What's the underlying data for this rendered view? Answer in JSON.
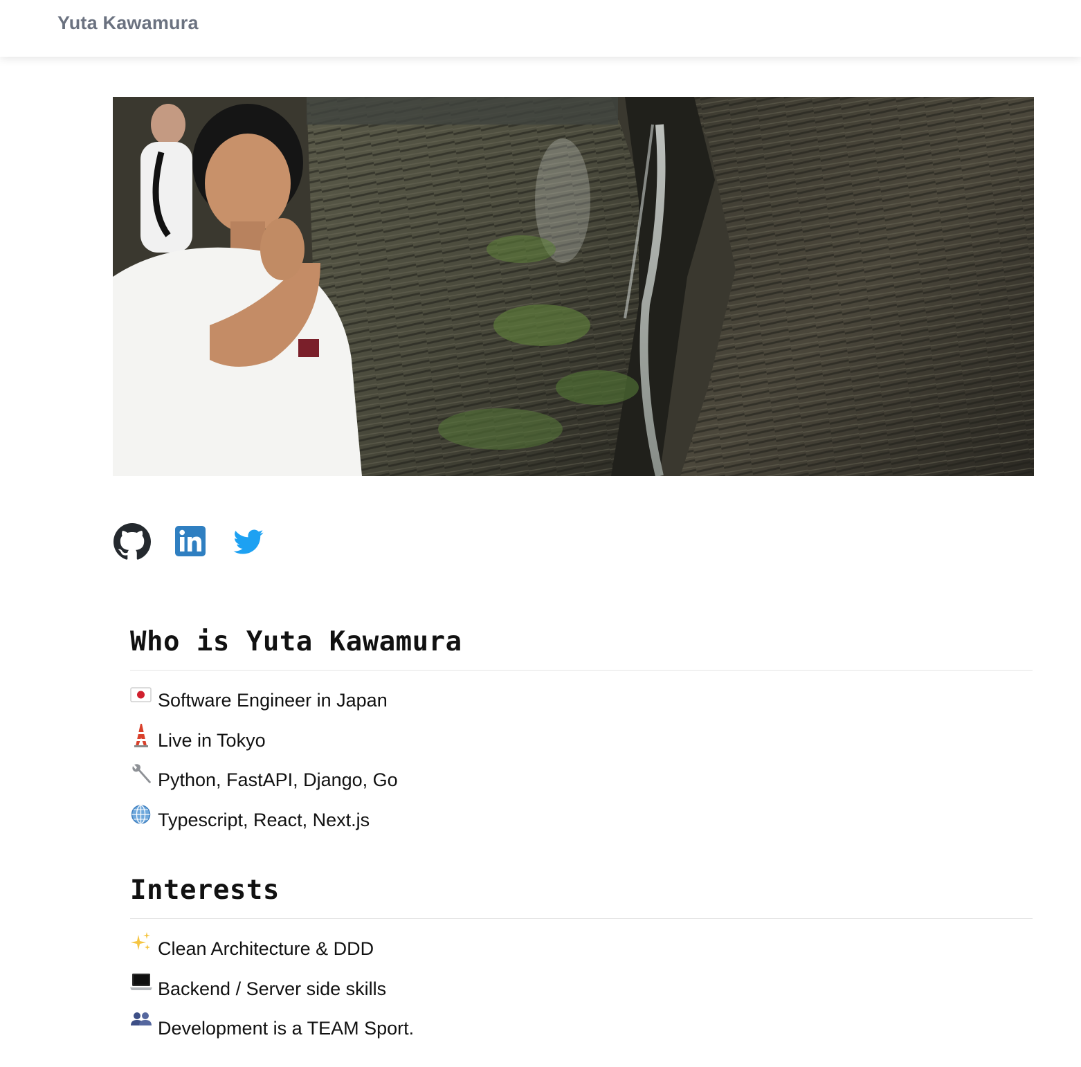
{
  "navbar": {
    "brand": "Yuta Kawamura"
  },
  "hero": {
    "alt": "Photo of Yuta Kawamura in front of a gorge with waterfalls"
  },
  "social": [
    {
      "name": "github",
      "icon": "github-icon",
      "color": "#24292e"
    },
    {
      "name": "linkedin",
      "icon": "linkedin-icon",
      "color": "#2f7fc1"
    },
    {
      "name": "twitter",
      "icon": "twitter-icon",
      "color": "#1da1f2"
    }
  ],
  "about": {
    "heading": "Who is Yuta Kawamura",
    "items": [
      {
        "icon": "japan-flag-icon",
        "text": "Software Engineer in Japan"
      },
      {
        "icon": "tokyo-tower-icon",
        "text": "Live in Tokyo"
      },
      {
        "icon": "wrench-icon",
        "text": "Python, FastAPI, Django, Go"
      },
      {
        "icon": "globe-icon",
        "text": "Typescript, React, Next.js"
      }
    ]
  },
  "interests": {
    "heading": "Interests",
    "items": [
      {
        "icon": "sparkles-icon",
        "text": "Clean Architecture & DDD"
      },
      {
        "icon": "laptop-icon",
        "text": "Backend / Server side skills"
      },
      {
        "icon": "people-icon",
        "text": "Development is a TEAM Sport."
      }
    ]
  }
}
